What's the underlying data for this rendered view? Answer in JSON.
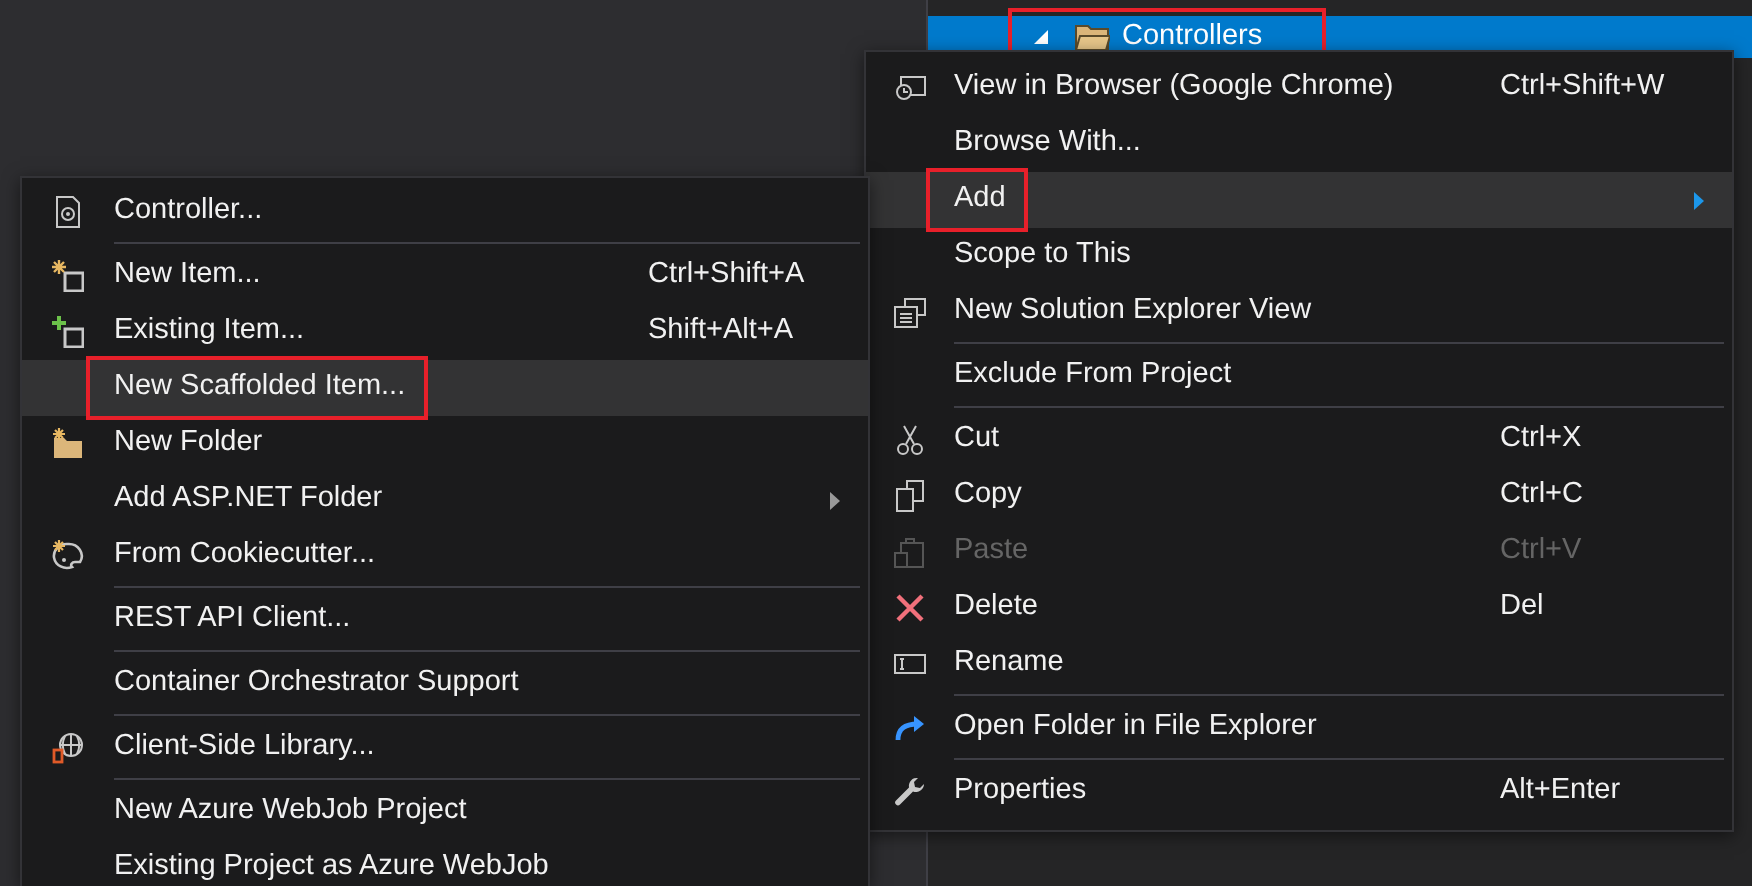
{
  "tree": {
    "items": [
      {
        "label": "Controllers",
        "expanded": true,
        "selected": true,
        "annotated": true
      }
    ]
  },
  "context_menu": {
    "items": [
      {
        "kind": "item",
        "label": "View in Browser (Google Chrome)",
        "shortcut": "Ctrl+Shift+W",
        "selected": false,
        "disabled": false,
        "annotated": false,
        "has_submenu": false
      },
      {
        "kind": "item",
        "label": "Browse With...",
        "selected": false,
        "disabled": false,
        "annotated": false,
        "has_submenu": false
      },
      {
        "kind": "item",
        "label": "Add",
        "selected": true,
        "disabled": false,
        "annotated": true,
        "has_submenu": true
      },
      {
        "kind": "item",
        "label": "Scope to This",
        "selected": false,
        "disabled": false,
        "annotated": false,
        "has_submenu": false
      },
      {
        "kind": "item",
        "label": "New Solution Explorer View",
        "selected": false,
        "disabled": false,
        "annotated": false,
        "has_submenu": false
      },
      {
        "kind": "separator"
      },
      {
        "kind": "item",
        "label": "Exclude From Project",
        "selected": false,
        "disabled": false,
        "annotated": false,
        "has_submenu": false
      },
      {
        "kind": "separator"
      },
      {
        "kind": "item",
        "label": "Cut",
        "shortcut": "Ctrl+X",
        "selected": false,
        "disabled": false,
        "annotated": false,
        "has_submenu": false
      },
      {
        "kind": "item",
        "label": "Copy",
        "shortcut": "Ctrl+C",
        "selected": false,
        "disabled": false,
        "annotated": false,
        "has_submenu": false
      },
      {
        "kind": "item",
        "label": "Paste",
        "shortcut": "Ctrl+V",
        "selected": false,
        "disabled": true,
        "annotated": false,
        "has_submenu": false
      },
      {
        "kind": "item",
        "label": "Delete",
        "shortcut": "Del",
        "selected": false,
        "disabled": false,
        "annotated": false,
        "has_submenu": false
      },
      {
        "kind": "item",
        "label": "Rename",
        "selected": false,
        "disabled": false,
        "annotated": false,
        "has_submenu": false
      },
      {
        "kind": "separator"
      },
      {
        "kind": "item",
        "label": "Open Folder in File Explorer",
        "selected": false,
        "disabled": false,
        "annotated": false,
        "has_submenu": false
      },
      {
        "kind": "separator"
      },
      {
        "kind": "item",
        "label": "Properties",
        "shortcut": "Alt+Enter",
        "selected": false,
        "disabled": false,
        "annotated": false,
        "has_submenu": false
      }
    ]
  },
  "add_submenu": {
    "items": [
      {
        "kind": "item",
        "label": "Controller...",
        "selected": false,
        "disabled": false,
        "annotated": false,
        "has_submenu": false
      },
      {
        "kind": "separator"
      },
      {
        "kind": "item",
        "label": "New Item...",
        "shortcut": "Ctrl+Shift+A",
        "selected": false,
        "disabled": false,
        "annotated": false,
        "has_submenu": false
      },
      {
        "kind": "item",
        "label": "Existing Item...",
        "shortcut": "Shift+Alt+A",
        "selected": false,
        "disabled": false,
        "annotated": false,
        "has_submenu": false
      },
      {
        "kind": "item",
        "label": "New Scaffolded Item...",
        "selected": true,
        "disabled": false,
        "annotated": true,
        "has_submenu": false
      },
      {
        "kind": "item",
        "label": "New Folder",
        "selected": false,
        "disabled": false,
        "annotated": false,
        "has_submenu": false
      },
      {
        "kind": "item",
        "label": "Add ASP.NET Folder",
        "selected": false,
        "disabled": false,
        "annotated": false,
        "has_submenu": true
      },
      {
        "kind": "item",
        "label": "From Cookiecutter...",
        "selected": false,
        "disabled": false,
        "annotated": false,
        "has_submenu": false
      },
      {
        "kind": "separator"
      },
      {
        "kind": "item",
        "label": "REST API Client...",
        "selected": false,
        "disabled": false,
        "annotated": false,
        "has_submenu": false
      },
      {
        "kind": "separator"
      },
      {
        "kind": "item",
        "label": "Container Orchestrator Support",
        "selected": false,
        "disabled": false,
        "annotated": false,
        "has_submenu": false
      },
      {
        "kind": "separator"
      },
      {
        "kind": "item",
        "label": "Client-Side Library...",
        "selected": false,
        "disabled": false,
        "annotated": false,
        "has_submenu": false
      },
      {
        "kind": "separator"
      },
      {
        "kind": "item",
        "label": "New Azure WebJob Project",
        "selected": false,
        "disabled": false,
        "annotated": false,
        "has_submenu": false
      },
      {
        "kind": "item",
        "label": "Existing Project as Azure WebJob",
        "selected": false,
        "disabled": false,
        "annotated": false,
        "has_submenu": false
      }
    ]
  }
}
